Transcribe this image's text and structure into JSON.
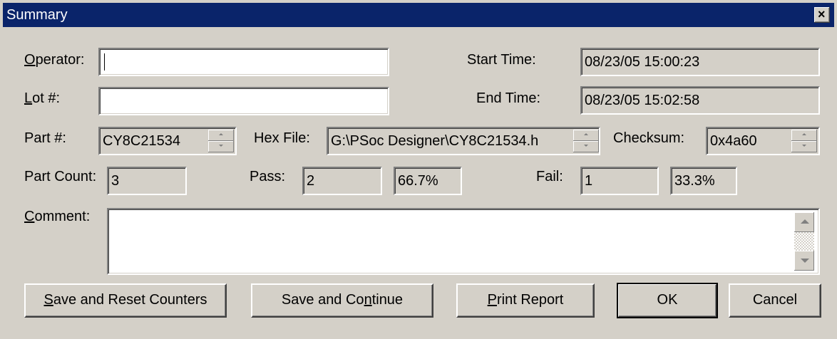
{
  "window": {
    "title": "Summary"
  },
  "fields": {
    "operator": {
      "label_pre": "",
      "label_ul": "O",
      "label_post": "perator:",
      "value": ""
    },
    "lot": {
      "label_pre": "",
      "label_ul": "L",
      "label_post": "ot #:",
      "value": ""
    },
    "start_time": {
      "label": "Start Time:",
      "value": "08/23/05  15:00:23"
    },
    "end_time": {
      "label": "End Time:",
      "value": "08/23/05  15:02:58"
    },
    "part": {
      "label": "Part #:",
      "value": "CY8C21534"
    },
    "hex_file": {
      "label": "Hex File:",
      "value": "G:\\PSoc Designer\\CY8C21534.h"
    },
    "checksum": {
      "label": "Checksum:",
      "value": "0x4a60"
    },
    "part_count": {
      "label": "Part Count:",
      "value": "3"
    },
    "pass": {
      "label": "Pass:",
      "count": "2",
      "percent": "66.7%"
    },
    "fail": {
      "label": "Fail:",
      "count": "1",
      "percent": "33.3%"
    },
    "comment": {
      "label_pre": "",
      "label_ul": "C",
      "label_post": "omment:",
      "value": ""
    }
  },
  "buttons": {
    "save_reset": {
      "pre": "",
      "ul": "S",
      "post": "ave and Reset Counters"
    },
    "save_continue": {
      "pre": "Save and Co",
      "ul": "n",
      "post": "tinue"
    },
    "print_report": {
      "pre": "",
      "ul": "P",
      "post": "rint Report"
    },
    "ok": {
      "label": "OK"
    },
    "cancel": {
      "label": "Cancel"
    }
  },
  "icons": {
    "close": "close-icon",
    "spin_up": "spin-up-icon",
    "spin_down": "spin-down-icon",
    "scroll_up": "scroll-up-icon",
    "scroll_down": "scroll-down-icon"
  }
}
